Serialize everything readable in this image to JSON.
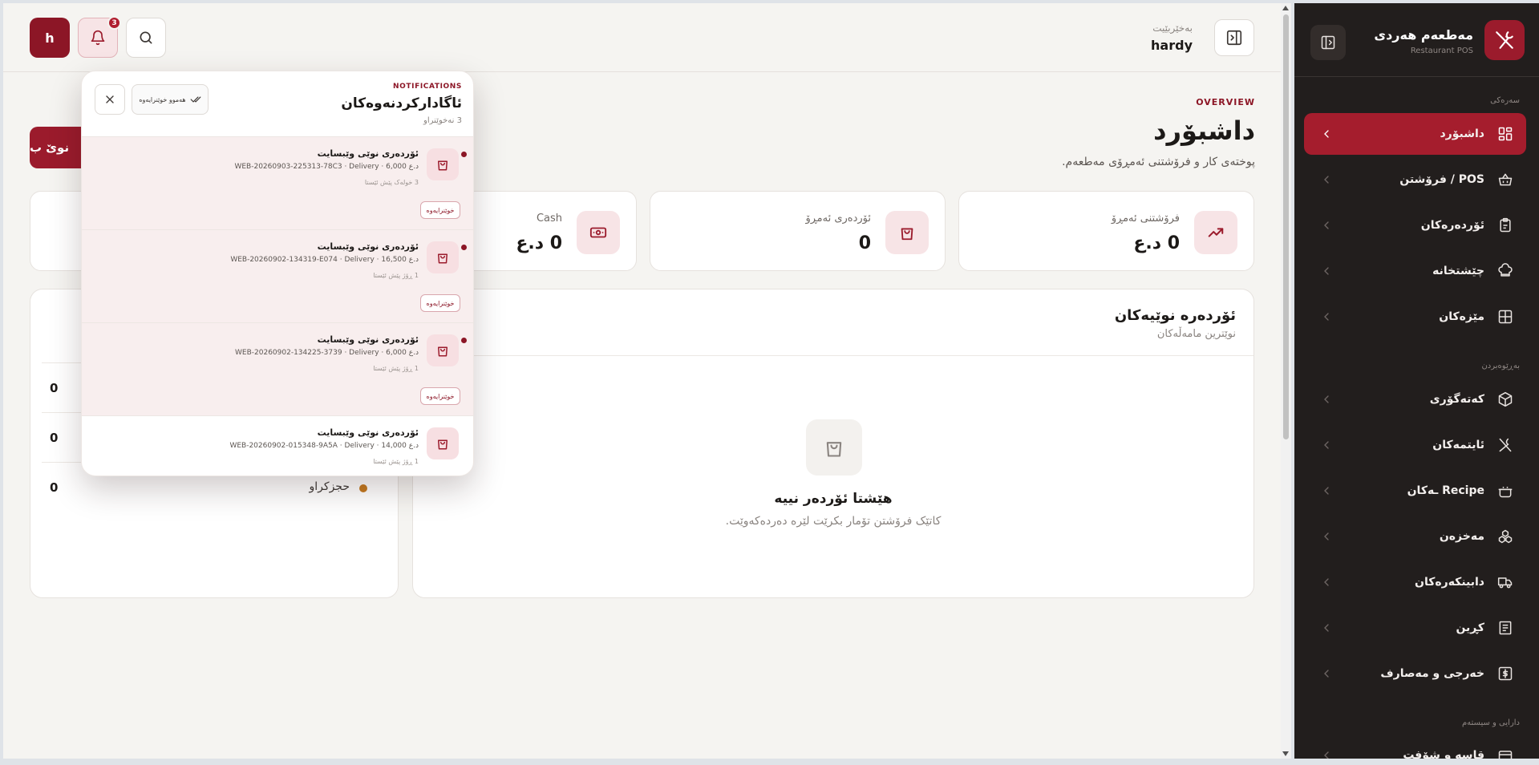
{
  "colors": {
    "brand": "#9b1b2c",
    "sidebar_bg": "#221e1d",
    "page_bg": "#f5f4f1",
    "accent_soft": "#f7e4e6"
  },
  "sidebar": {
    "title": "مەطعەم هەردی",
    "subtitle": "Restaurant POS",
    "sections": {
      "main": "سەرەکی",
      "management": "بەڕێوەبردن",
      "finance": "دارایی و سیستەم"
    },
    "items": [
      {
        "label": "داشبۆرد",
        "icon": "grid-icon",
        "active": true
      },
      {
        "label": "POS / فرۆشتن",
        "icon": "basket-icon"
      },
      {
        "label": "ئۆردەرەکان",
        "icon": "clipboard-icon"
      },
      {
        "label": "چێشتخانە",
        "icon": "chef-hat-icon"
      },
      {
        "label": "مێزەکان",
        "icon": "table-icon"
      },
      {
        "label": "کەتەگۆری",
        "icon": "box-icon"
      },
      {
        "label": "ئایتمەکان",
        "icon": "utensils-icon"
      },
      {
        "label": "Recipe ـەکان",
        "icon": "pot-icon"
      },
      {
        "label": "مەخزەن",
        "icon": "boxes-icon"
      },
      {
        "label": "دابینکەرەکان",
        "icon": "truck-icon"
      },
      {
        "label": "کڕین",
        "icon": "receipt-icon"
      },
      {
        "label": "خەرجی و مەصارف",
        "icon": "dollar-icon"
      },
      {
        "label": "قاسە و شۆفت",
        "icon": "cashbox-icon"
      }
    ]
  },
  "topbar": {
    "welcome": "بەخێربێیت",
    "user": "hardy",
    "avatar_letter": "h",
    "notif_count": "3"
  },
  "overview": {
    "tag": "OVERVIEW",
    "title": "داشبۆرد",
    "subtitle": "پوختەی کار و فرۆشتنی ئەمڕۆی مەطعەم.",
    "new_button": "نوێ ب"
  },
  "cards": [
    {
      "label": "فرۆشتنی ئەمڕۆ",
      "value": "0 د.ع",
      "icon": "trending-up-icon"
    },
    {
      "label": "ئۆردەری ئەمڕۆ",
      "value": "0",
      "icon": "bag-icon"
    },
    {
      "label": "Cash",
      "value": "0 د.ع",
      "icon": "cash-icon"
    }
  ],
  "recent_orders": {
    "title": "ئۆردەرە نوێیەکان",
    "subtitle": "نوێترین مامەڵەکان",
    "empty_title": "هێشتا ئۆردەر نییە",
    "empty_sub": "کاتێک فرۆشتن تۆمار بکرێت لێرە دەردەکەوێت."
  },
  "status_list": [
    {
      "label": "",
      "value": "0"
    },
    {
      "label": "",
      "value": "0"
    },
    {
      "label": "حجزکراو",
      "value": "0"
    }
  ],
  "notifications": {
    "tag": "NOTIFICATIONS",
    "title": "ئاگادارکردنەوەکان",
    "count": "3 نەخوێنراو",
    "mark_all": "هەموو خوێنرایەوە",
    "items": [
      {
        "title": "ئۆردەری نوێی وێبسایت",
        "detail": "WEB-20260903-225313-78C3 · Delivery · 6,000 د.ع",
        "time": "3 خولەک پێش ئێستا",
        "button": "خوێنرایەوە",
        "unread": true
      },
      {
        "title": "ئۆردەری نوێی وێبسایت",
        "detail": "WEB-20260902-134319-E074 · Delivery · 16,500 د.ع",
        "time": "1 ڕۆژ پێش ئێستا",
        "button": "خوێنرایەوە",
        "unread": true
      },
      {
        "title": "ئۆردەری نوێی وێبسایت",
        "detail": "WEB-20260902-134225-3739 · Delivery · 6,000 د.ع",
        "time": "1 ڕۆژ پێش ئێستا",
        "button": "خوێنرایەوە",
        "unread": true
      },
      {
        "title": "ئۆردەری نوێی وێبسایت",
        "detail": "WEB-20260902-015348-9A5A · Delivery · 14,000 د.ع",
        "time": "1 ڕۆژ پێش ئێستا",
        "button": "",
        "unread": false
      }
    ]
  }
}
